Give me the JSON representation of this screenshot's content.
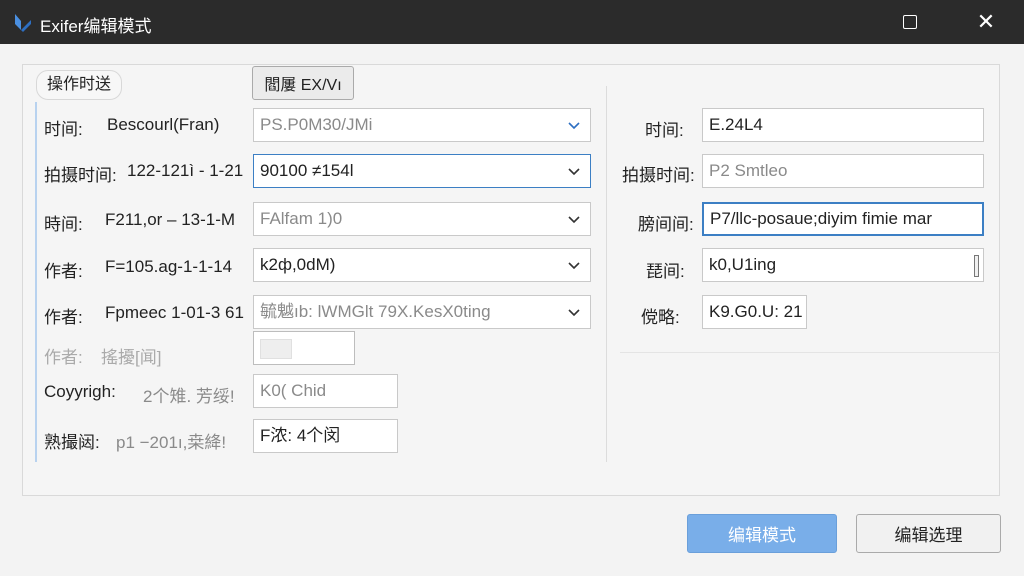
{
  "window": {
    "title": "Exifer编辑模式",
    "logo_icon": "app-logo-icon",
    "accent_color": "#3c7fc4"
  },
  "tabs": {
    "operate_label": "操作时送"
  },
  "ex_button": {
    "label": "閻屢 EX/Vı"
  },
  "left_rows": [
    {
      "label": "时间:",
      "value": "Bescourl(Fran)",
      "combo": "PS.P0M30/JMi"
    },
    {
      "label": "拍摄时间:",
      "value": "122-121ì - 1-21",
      "combo": "90100 ≠154l"
    },
    {
      "label": "時间:",
      "value": "F211,or – 13-1-M",
      "combo": "FAlfam 1)0"
    },
    {
      "label": "作者:",
      "value": "F=105.ag-1-1-14",
      "combo": "k2ф,0dM)"
    },
    {
      "label": "作者:",
      "value": "Fpmeec 1-01-3 61",
      "combo": "毓魆ıb: lWMGlt 79X.KesX0ting"
    },
    {
      "label": "作者:",
      "value": "搖擾[闻]"
    },
    {
      "label": "Coyyrigh:",
      "value": "2个雉. 芳绥!",
      "field": "K0( Chid"
    },
    {
      "label": "熟撮闼:",
      "value": "p1 −201ı,桒絳!",
      "field": "F浓: 4个闵"
    }
  ],
  "right_rows": [
    {
      "label": "时间:",
      "field": "E.24L4"
    },
    {
      "label": "拍摄时间:",
      "field": "P2 Smtleo"
    },
    {
      "label": "膀间间:",
      "field": "P7/llc-posaue;diyim fimie mar"
    },
    {
      "label": "琵间:",
      "field": "k0,U1ing"
    },
    {
      "label": "傥略:",
      "field": "K9.G0.U: 21"
    }
  ],
  "footer": {
    "primary_label": "编辑模式",
    "secondary_label": "编辑选理"
  }
}
